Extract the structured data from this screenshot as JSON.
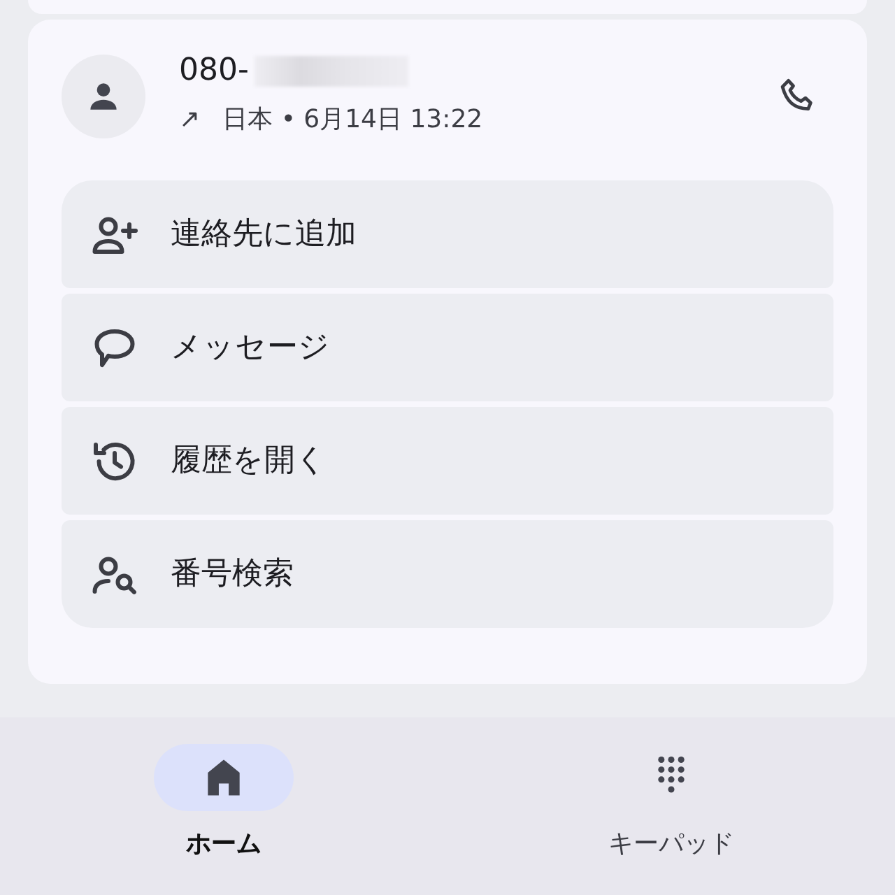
{
  "call_entry": {
    "number": "080-",
    "direction": "↗",
    "detail": "日本 • 6月14日 13:22"
  },
  "actions": [
    {
      "kind": "add-contact",
      "label": "連絡先に追加"
    },
    {
      "kind": "message",
      "label": "メッセージ"
    },
    {
      "kind": "history",
      "label": "履歴を開く"
    },
    {
      "kind": "lookup",
      "label": "番号検索"
    }
  ],
  "bottom_nav": [
    {
      "kind": "home",
      "label": "ホーム",
      "selected": true
    },
    {
      "kind": "keypad",
      "label": "キーパッド",
      "selected": false
    }
  ]
}
